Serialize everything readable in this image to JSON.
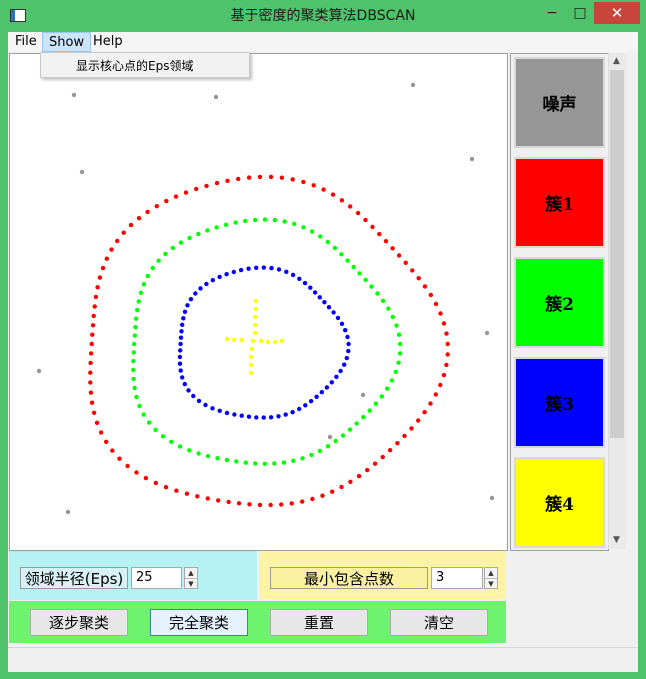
{
  "window": {
    "title": "基于密度的聚类算法DBSCAN",
    "minimize": "−",
    "maximize": "□",
    "close": "✕"
  },
  "menu": {
    "file": "File",
    "show": "Show",
    "help": "Help",
    "show_items": [
      "显示核心点的Eps领域"
    ]
  },
  "legend": [
    {
      "label": "噪声",
      "color": "#969696"
    },
    {
      "label": "簇1",
      "color": "#ff0000"
    },
    {
      "label": "簇2",
      "color": "#00ff00"
    },
    {
      "label": "簇3",
      "color": "#0000ff"
    },
    {
      "label": "簇4",
      "color": "#ffff00"
    }
  ],
  "params": {
    "eps_label": "领域半径(Eps)",
    "eps_value": "25",
    "minpts_label": "最小包含点数",
    "minpts_value": "3",
    "spin_up": "▲",
    "spin_down": "▼"
  },
  "buttons": {
    "step": "逐步聚类",
    "full": "完全聚类",
    "reset": "重置",
    "clear": "清空"
  },
  "scrollbar": {
    "up": "▲",
    "down": "▼"
  }
}
